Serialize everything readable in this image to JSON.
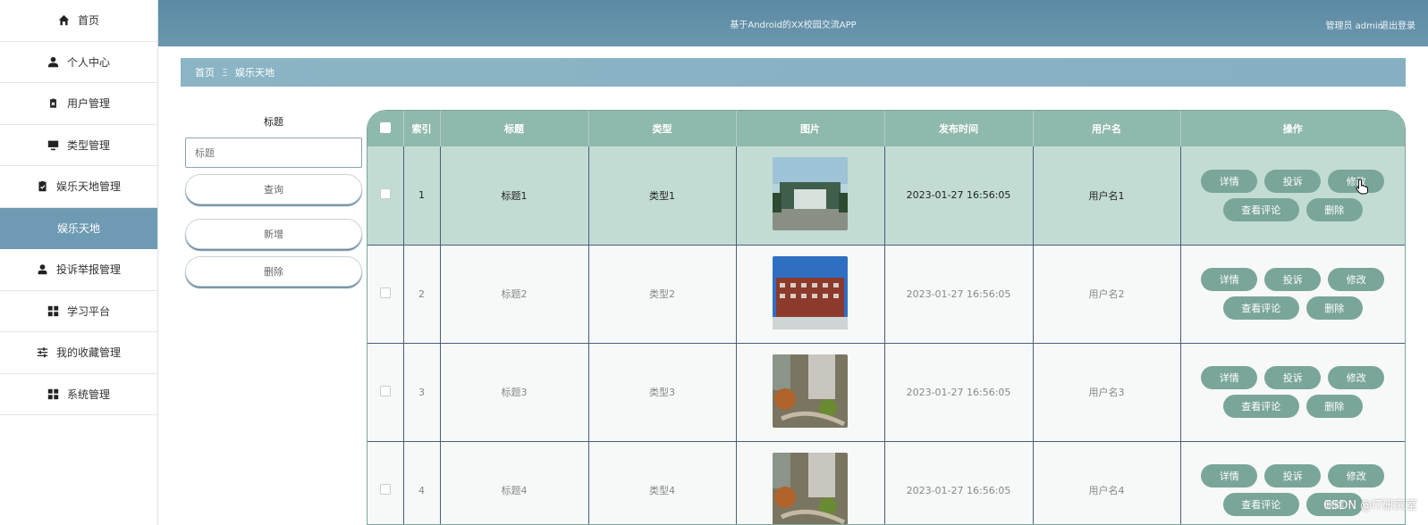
{
  "sidebar": {
    "items": [
      {
        "label": "首页",
        "icon": "home-icon"
      },
      {
        "label": "个人中心",
        "icon": "user-icon"
      },
      {
        "label": "用户管理",
        "icon": "clipboard-x-icon"
      },
      {
        "label": "类型管理",
        "icon": "monitor-icon"
      },
      {
        "label": "娱乐天地管理",
        "icon": "clipboard-check-icon"
      },
      {
        "label": "娱乐天地",
        "icon": ""
      },
      {
        "label": "投诉举报管理",
        "icon": "user-report-icon"
      },
      {
        "label": "学习平台",
        "icon": "grid-icon"
      },
      {
        "label": "我的收藏管理",
        "icon": "sliders-icon"
      },
      {
        "label": "系统管理",
        "icon": "grid-icon"
      }
    ]
  },
  "header": {
    "title": "基于Android的XX校园交流APP",
    "user": "管理员 admin",
    "logout": "退出登录",
    "color": "#6a97ae"
  },
  "breadcrumb": {
    "home": "首页",
    "separator": "Ξ",
    "current": "娱乐天地"
  },
  "search": {
    "label": "标题",
    "placeholder": "标题",
    "query_button": "查询",
    "add_button": "新增",
    "delete_button": "删除"
  },
  "table": {
    "headers": [
      "索引",
      "标题",
      "类型",
      "图片",
      "发布时间",
      "用户名",
      "操作"
    ],
    "rows": [
      {
        "index": "1",
        "title": "标题1",
        "type": "类型1",
        "time": "2023-01-27 16:56:05",
        "user": "用户名1"
      },
      {
        "index": "2",
        "title": "标题2",
        "type": "类型2",
        "time": "2023-01-27 16:56:05",
        "user": "用户名2"
      },
      {
        "index": "3",
        "title": "标题3",
        "type": "类型3",
        "time": "2023-01-27 16:56:05",
        "user": "用户名3"
      },
      {
        "index": "4",
        "title": "标题4",
        "type": "类型4",
        "time": "2023-01-27 16:56:05",
        "user": "用户名4"
      }
    ],
    "actions": {
      "detail": "详情",
      "complain": "投诉",
      "edit": "修改",
      "comments": "查看评论",
      "delete": "删除"
    },
    "accent_color": "#7aa69a"
  },
  "watermark": "CSDN @IT研究室"
}
